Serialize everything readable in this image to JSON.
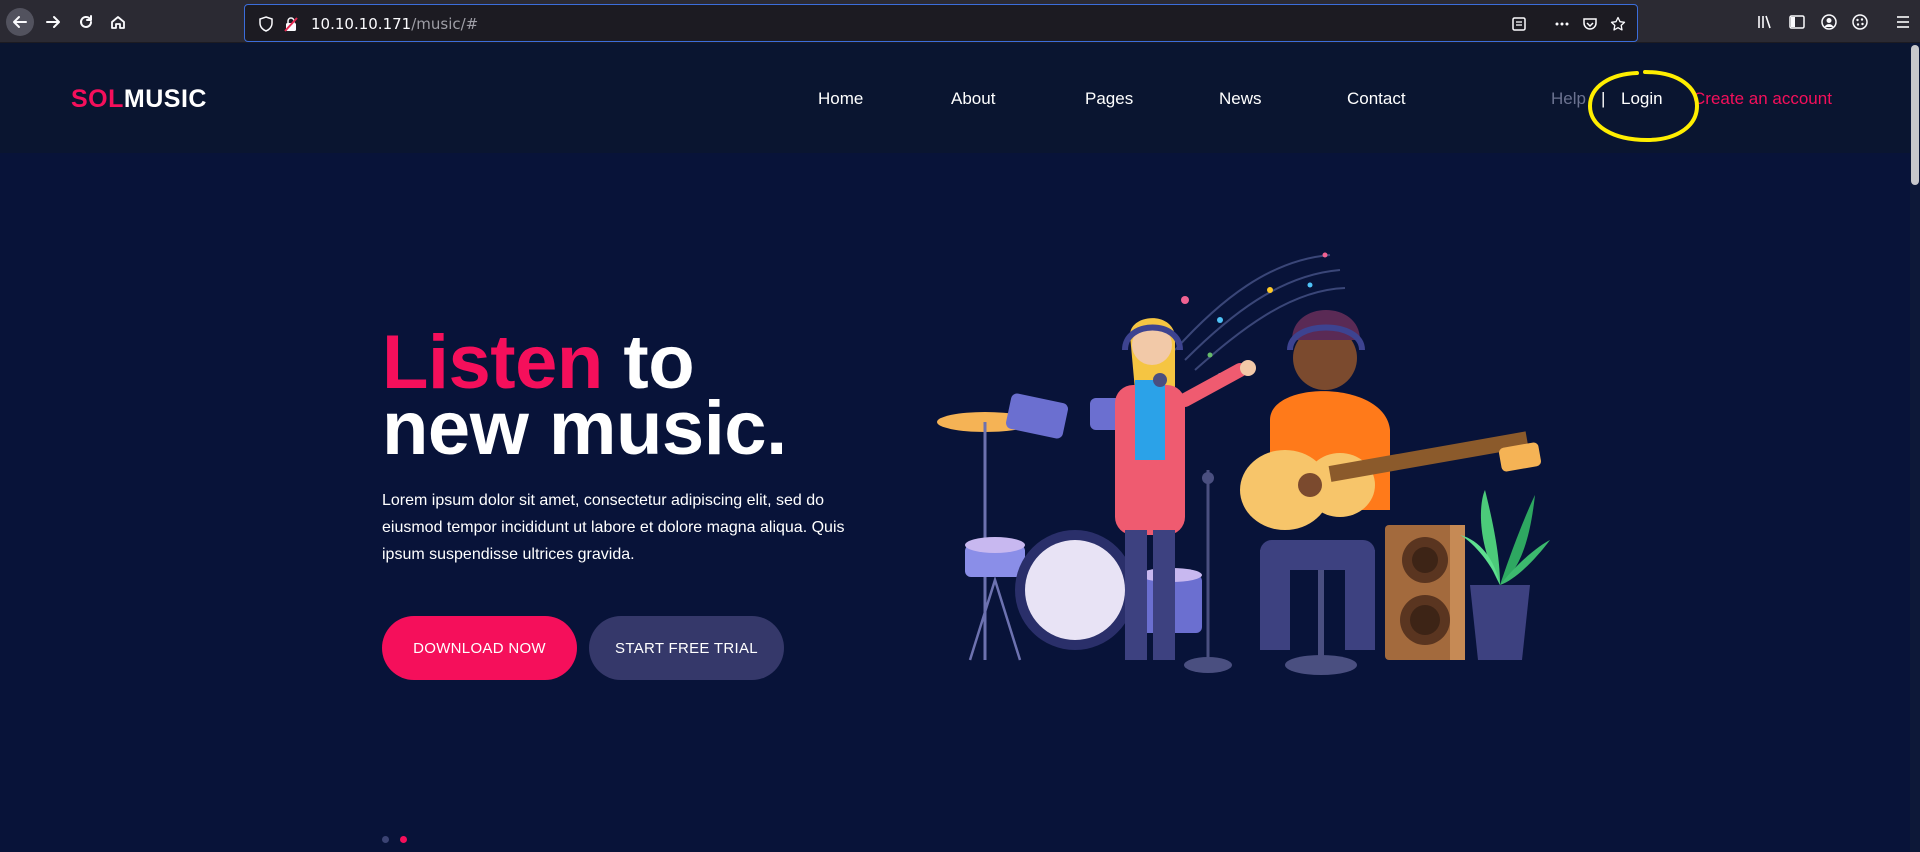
{
  "browser": {
    "url_host": "10.10.10.171",
    "url_path": "/music/#"
  },
  "site": {
    "logo_accent": "SOL",
    "logo_main": "MUSIC",
    "nav": [
      "Home",
      "About",
      "Pages",
      "News",
      "Contact"
    ],
    "help": "Help",
    "separator": "|",
    "login": "Login",
    "create_account": "Create an account"
  },
  "hero": {
    "title_accent": "Listen",
    "title_rest_line1": " to",
    "title_line2": "new music.",
    "text": "Lorem ipsum dolor sit amet, consectetur adipiscing elit, sed do eiusmod tempor incididunt ut labore et dolore magna aliqua. Quis ipsum suspendisse ultrices gravida.",
    "download_button": "DOWNLOAD NOW",
    "trial_button": "START FREE TRIAL"
  },
  "slider": {
    "active_index": 2,
    "count": 2
  },
  "colors": {
    "accent": "#f50f5b",
    "background": "#081339",
    "header": "#0a1530",
    "secondary_button": "#35386a",
    "annotation": "#ffee00"
  },
  "icons": [
    "back-arrow-icon",
    "forward-arrow-icon",
    "reload-icon",
    "home-icon",
    "shield-icon",
    "insecure-lock-icon",
    "reader-view-icon",
    "more-icon",
    "pocket-icon",
    "bookmark-star-icon",
    "library-icon",
    "sidebar-icon",
    "account-icon",
    "extension-icon",
    "menu-icon"
  ]
}
